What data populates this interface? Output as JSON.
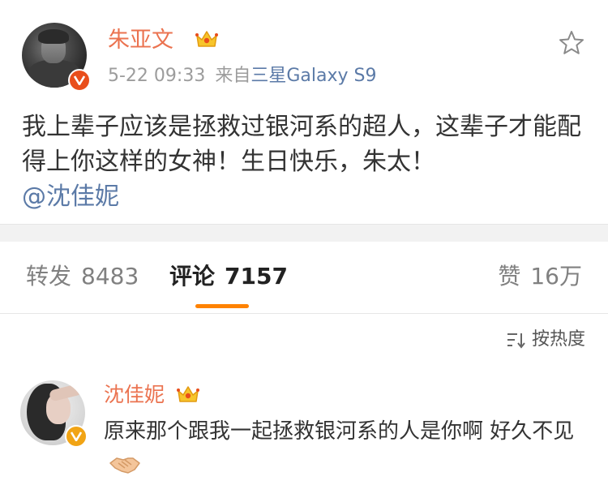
{
  "post": {
    "username": "朱亚文",
    "time": "5-22 09:33",
    "source_prefix": "来自",
    "source_device": "三星Galaxy S9",
    "text_main": "我上辈子应该是拯救过银河系的超人，这辈子才能配得上你这样的女神！生日快乐，朱太！",
    "mention": "@沈佳妮"
  },
  "tabs": {
    "repost_label": "转发",
    "repost_count": "8483",
    "comment_label": "评论",
    "comment_count": "7157",
    "like_label": "赞",
    "like_count": "16万"
  },
  "sort": {
    "label": "按热度"
  },
  "comment": {
    "username": "沈佳妮",
    "text": "原来那个跟我一起拯救银河系的人是你啊 好久不见"
  },
  "colors": {
    "username": "#eb7350",
    "link": "#5b7aa7",
    "accent": "#ff8200",
    "verified_red": "#e94e1b",
    "verified_yellow": "#f1a415"
  },
  "icons": {
    "favorite": "star-outline-icon",
    "verified": "verified-v-icon",
    "member": "crown-icon",
    "sort": "sort-icon",
    "emoji": "handshake-emoji-icon"
  }
}
